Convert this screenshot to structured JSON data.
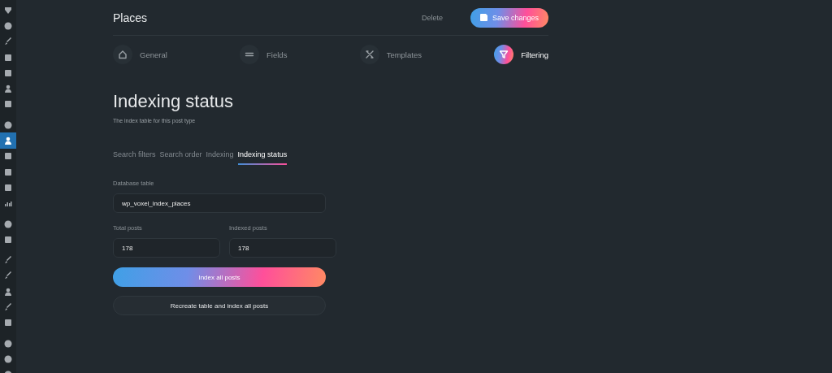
{
  "sidebar": {
    "groups": [
      [
        {
          "kind": "shield",
          "selected": false
        },
        {
          "kind": "circle",
          "selected": false
        },
        {
          "kind": "brush",
          "selected": false
        },
        {
          "kind": "square",
          "selected": false
        },
        {
          "kind": "square",
          "selected": false
        },
        {
          "kind": "person",
          "selected": false
        },
        {
          "kind": "square",
          "selected": false
        }
      ],
      [
        {
          "kind": "circle",
          "selected": false
        },
        {
          "kind": "person",
          "selected": true
        },
        {
          "kind": "square",
          "selected": false
        },
        {
          "kind": "square",
          "selected": false
        },
        {
          "kind": "square",
          "selected": false
        },
        {
          "kind": "bars",
          "selected": false
        }
      ],
      [
        {
          "kind": "circle",
          "selected": false
        },
        {
          "kind": "square",
          "selected": false
        }
      ],
      [
        {
          "kind": "brush",
          "selected": false
        },
        {
          "kind": "brush",
          "selected": false
        },
        {
          "kind": "person",
          "selected": false
        },
        {
          "kind": "brush",
          "selected": false
        },
        {
          "kind": "square",
          "selected": false
        }
      ],
      [
        {
          "kind": "circle",
          "selected": false
        },
        {
          "kind": "circle",
          "selected": false
        },
        {
          "kind": "circle",
          "selected": false
        }
      ]
    ]
  },
  "header": {
    "title": "Places",
    "delete": "Delete",
    "save": "Save changes"
  },
  "steps": [
    {
      "label": "General",
      "kind": "home",
      "selected": false
    },
    {
      "label": "Fields",
      "kind": "lines",
      "selected": false
    },
    {
      "label": "Templates",
      "kind": "tools",
      "selected": false
    },
    {
      "label": "Filtering",
      "kind": "filter",
      "selected": true
    }
  ],
  "section": {
    "title": "Indexing status",
    "subtitle": "The index table for this post type"
  },
  "tabs": [
    {
      "label": "Search filters",
      "selected": false
    },
    {
      "label": "Search order",
      "selected": false
    },
    {
      "label": "Indexing",
      "selected": false
    },
    {
      "label": "Indexing status",
      "selected": true
    }
  ],
  "form": {
    "database_table": {
      "label": "Database table",
      "value": "wp_voxel_index_places"
    },
    "total_posts": {
      "label": "Total posts",
      "value": "178"
    },
    "indexed_posts": {
      "label": "Indexed posts",
      "value": "178"
    },
    "index_button": "Index all posts",
    "recreate_button": "Recreate table and index all posts"
  }
}
